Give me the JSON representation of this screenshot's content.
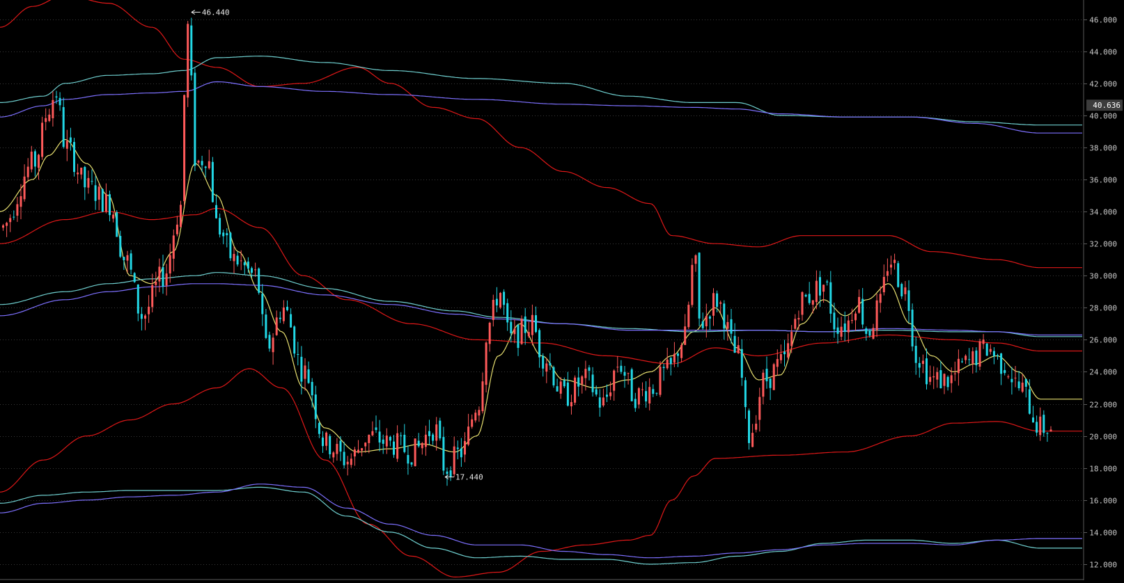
{
  "chart_data": {
    "type": "candlestick",
    "y_axis": {
      "position": "right",
      "range": [
        11.0,
        47.2
      ],
      "ticks": [
        "46.000",
        "44.000",
        "42.000",
        "40.000",
        "38.000",
        "36.000",
        "34.000",
        "32.000",
        "30.000",
        "28.000",
        "26.000",
        "24.000",
        "22.000",
        "20.000",
        "18.000",
        "16.000",
        "14.000",
        "12.000"
      ]
    },
    "grid": "dotted horizontal",
    "current_price_label": "40.636",
    "current_price_value": 40.636,
    "annotations": [
      {
        "text": "46.440",
        "value": 46.44,
        "kind": "period-high",
        "x_frac": 0.176
      },
      {
        "text": "17.440",
        "value": 17.44,
        "kind": "period-low",
        "x_frac": 0.41
      }
    ],
    "colors": {
      "background": "#000000",
      "grid": "#3a3a3a",
      "axis_text": "#c8c8c8",
      "up_candle": "#ff5a5a",
      "down_candle": "#22d8e6",
      "ma_short": "#e8e070",
      "band_red": "#e01818",
      "band_cyan": "#6fd0d0",
      "band_blue": "#7d70ff",
      "price_box_bg": "#3c3c3c"
    },
    "price_path": [
      [
        0.0,
        33.0
      ],
      [
        0.03,
        37.0
      ],
      [
        0.045,
        40.5
      ],
      [
        0.05,
        41.5
      ],
      [
        0.06,
        38.0
      ],
      [
        0.08,
        35.5
      ],
      [
        0.1,
        34.5
      ],
      [
        0.115,
        31.0
      ],
      [
        0.13,
        27.5
      ],
      [
        0.15,
        30.0
      ],
      [
        0.165,
        34.0
      ],
      [
        0.172,
        45.5
      ],
      [
        0.18,
        37.0
      ],
      [
        0.19,
        37.5
      ],
      [
        0.2,
        33.0
      ],
      [
        0.215,
        31.0
      ],
      [
        0.235,
        30.0
      ],
      [
        0.245,
        25.5
      ],
      [
        0.26,
        28.0
      ],
      [
        0.28,
        24.0
      ],
      [
        0.3,
        19.5
      ],
      [
        0.32,
        18.5
      ],
      [
        0.34,
        20.0
      ],
      [
        0.36,
        19.5
      ],
      [
        0.38,
        19.0
      ],
      [
        0.4,
        20.5
      ],
      [
        0.41,
        18.0
      ],
      [
        0.425,
        19.0
      ],
      [
        0.44,
        22.0
      ],
      [
        0.45,
        27.0
      ],
      [
        0.46,
        29.0
      ],
      [
        0.47,
        26.0
      ],
      [
        0.49,
        27.0
      ],
      [
        0.5,
        25.0
      ],
      [
        0.52,
        22.5
      ],
      [
        0.54,
        23.5
      ],
      [
        0.555,
        22.0
      ],
      [
        0.57,
        24.5
      ],
      [
        0.585,
        22.5
      ],
      [
        0.6,
        23.0
      ],
      [
        0.615,
        24.0
      ],
      [
        0.63,
        26.0
      ],
      [
        0.64,
        31.0
      ],
      [
        0.645,
        27.0
      ],
      [
        0.66,
        28.5
      ],
      [
        0.68,
        25.0
      ],
      [
        0.69,
        20.0
      ],
      [
        0.705,
        23.5
      ],
      [
        0.72,
        24.5
      ],
      [
        0.74,
        28.5
      ],
      [
        0.76,
        29.5
      ],
      [
        0.77,
        27.0
      ],
      [
        0.78,
        27.0
      ],
      [
        0.79,
        28.5
      ],
      [
        0.8,
        26.5
      ],
      [
        0.81,
        28.0
      ],
      [
        0.82,
        31.0
      ],
      [
        0.835,
        29.0
      ],
      [
        0.845,
        25.0
      ],
      [
        0.86,
        23.5
      ],
      [
        0.875,
        23.5
      ],
      [
        0.89,
        24.5
      ],
      [
        0.91,
        25.5
      ],
      [
        0.925,
        24.5
      ],
      [
        0.94,
        23.0
      ],
      [
        0.96,
        20.5
      ]
    ],
    "moving_averages": [
      {
        "color_key": "ma_short",
        "values": [
          [
            0.0,
            34.0
          ],
          [
            0.03,
            36.0
          ],
          [
            0.045,
            37.5
          ],
          [
            0.06,
            38.5
          ],
          [
            0.08,
            37.0
          ],
          [
            0.1,
            35.0
          ],
          [
            0.12,
            30.0
          ],
          [
            0.14,
            29.5
          ],
          [
            0.16,
            31.5
          ],
          [
            0.18,
            37.0
          ],
          [
            0.2,
            35.0
          ],
          [
            0.22,
            31.5
          ],
          [
            0.24,
            29.0
          ],
          [
            0.26,
            26.5
          ],
          [
            0.28,
            23.0
          ],
          [
            0.3,
            20.5
          ],
          [
            0.33,
            19.0
          ],
          [
            0.36,
            19.2
          ],
          [
            0.39,
            19.5
          ],
          [
            0.42,
            19.0
          ],
          [
            0.44,
            20.0
          ],
          [
            0.46,
            25.0
          ],
          [
            0.48,
            27.0
          ],
          [
            0.5,
            25.0
          ],
          [
            0.52,
            23.5
          ],
          [
            0.55,
            23.0
          ],
          [
            0.58,
            23.5
          ],
          [
            0.6,
            24.0
          ],
          [
            0.62,
            25.0
          ],
          [
            0.64,
            26.5
          ],
          [
            0.66,
            28.0
          ],
          [
            0.68,
            25.5
          ],
          [
            0.7,
            23.5
          ],
          [
            0.72,
            23.8
          ],
          [
            0.74,
            27.0
          ],
          [
            0.76,
            28.5
          ],
          [
            0.78,
            27.5
          ],
          [
            0.8,
            28.5
          ],
          [
            0.82,
            29.5
          ],
          [
            0.84,
            27.0
          ],
          [
            0.86,
            25.0
          ],
          [
            0.88,
            24.0
          ],
          [
            0.9,
            24.5
          ],
          [
            0.92,
            25.0
          ],
          [
            0.94,
            24.0
          ],
          [
            0.96,
            22.3
          ]
        ]
      },
      {
        "color_key": "band_red",
        "values": [
          [
            0.0,
            32.0
          ],
          [
            0.06,
            33.5
          ],
          [
            0.1,
            34.0
          ],
          [
            0.14,
            33.5
          ],
          [
            0.18,
            33.8
          ],
          [
            0.2,
            34.2
          ],
          [
            0.24,
            33.0
          ],
          [
            0.28,
            30.0
          ],
          [
            0.32,
            28.5
          ],
          [
            0.38,
            27.0
          ],
          [
            0.44,
            26.0
          ],
          [
            0.5,
            25.8
          ],
          [
            0.56,
            25.0
          ],
          [
            0.62,
            24.5
          ],
          [
            0.66,
            25.5
          ],
          [
            0.7,
            25.0
          ],
          [
            0.76,
            25.8
          ],
          [
            0.82,
            26.3
          ],
          [
            0.88,
            26.0
          ],
          [
            0.92,
            25.8
          ],
          [
            0.96,
            25.3
          ]
        ]
      },
      {
        "color_key": "band_red",
        "values": [
          [
            0.0,
            45.5
          ],
          [
            0.03,
            46.8
          ],
          [
            0.06,
            47.5
          ],
          [
            0.1,
            47.0
          ],
          [
            0.14,
            45.5
          ],
          [
            0.17,
            43.5
          ],
          [
            0.2,
            43.0
          ],
          [
            0.24,
            41.8
          ],
          [
            0.28,
            42.0
          ],
          [
            0.33,
            43.0
          ],
          [
            0.36,
            42.0
          ],
          [
            0.4,
            40.5
          ],
          [
            0.44,
            39.8
          ],
          [
            0.48,
            38.0
          ],
          [
            0.52,
            36.5
          ],
          [
            0.56,
            35.5
          ],
          [
            0.6,
            34.5
          ],
          [
            0.62,
            32.5
          ],
          [
            0.66,
            32.0
          ],
          [
            0.7,
            31.8
          ],
          [
            0.74,
            32.5
          ],
          [
            0.78,
            32.5
          ],
          [
            0.82,
            32.5
          ],
          [
            0.86,
            31.5
          ],
          [
            0.92,
            31.0
          ],
          [
            0.96,
            30.5
          ]
        ]
      },
      {
        "color_key": "band_red",
        "values": [
          [
            0.0,
            16.5
          ],
          [
            0.04,
            18.5
          ],
          [
            0.08,
            20.0
          ],
          [
            0.12,
            21.0
          ],
          [
            0.16,
            22.0
          ],
          [
            0.2,
            23.0
          ],
          [
            0.23,
            24.2
          ],
          [
            0.26,
            23.0
          ],
          [
            0.3,
            18.5
          ],
          [
            0.34,
            14.5
          ],
          [
            0.38,
            12.5
          ],
          [
            0.42,
            11.2
          ],
          [
            0.46,
            11.5
          ],
          [
            0.5,
            12.8
          ],
          [
            0.54,
            13.2
          ],
          [
            0.58,
            13.5
          ],
          [
            0.6,
            13.8
          ],
          [
            0.62,
            16.0
          ],
          [
            0.64,
            17.5
          ],
          [
            0.66,
            18.6
          ],
          [
            0.72,
            18.8
          ],
          [
            0.78,
            19.0
          ],
          [
            0.84,
            20.0
          ],
          [
            0.88,
            20.8
          ],
          [
            0.92,
            20.9
          ],
          [
            0.96,
            20.3
          ]
        ]
      },
      {
        "color_key": "band_cyan",
        "values": [
          [
            0.0,
            40.8
          ],
          [
            0.04,
            41.2
          ],
          [
            0.06,
            42.0
          ],
          [
            0.1,
            42.5
          ],
          [
            0.14,
            42.6
          ],
          [
            0.17,
            42.8
          ],
          [
            0.2,
            43.6
          ],
          [
            0.24,
            43.7
          ],
          [
            0.3,
            43.3
          ],
          [
            0.36,
            42.8
          ],
          [
            0.44,
            42.3
          ],
          [
            0.52,
            42.0
          ],
          [
            0.58,
            41.2
          ],
          [
            0.64,
            40.8
          ],
          [
            0.68,
            40.8
          ],
          [
            0.72,
            40.0
          ],
          [
            0.78,
            39.9
          ],
          [
            0.84,
            39.9
          ],
          [
            0.9,
            39.6
          ],
          [
            0.96,
            39.4
          ]
        ]
      },
      {
        "color_key": "band_blue",
        "values": [
          [
            0.0,
            39.9
          ],
          [
            0.04,
            40.6
          ],
          [
            0.06,
            41.0
          ],
          [
            0.1,
            41.3
          ],
          [
            0.14,
            41.4
          ],
          [
            0.17,
            41.5
          ],
          [
            0.2,
            42.1
          ],
          [
            0.24,
            41.8
          ],
          [
            0.3,
            41.5
          ],
          [
            0.36,
            41.3
          ],
          [
            0.44,
            41.0
          ],
          [
            0.52,
            40.7
          ],
          [
            0.58,
            40.6
          ],
          [
            0.64,
            40.5
          ],
          [
            0.68,
            40.4
          ],
          [
            0.72,
            40.1
          ],
          [
            0.78,
            39.9
          ],
          [
            0.84,
            39.9
          ],
          [
            0.9,
            39.5
          ],
          [
            0.96,
            38.9
          ]
        ]
      },
      {
        "color_key": "band_cyan",
        "values": [
          [
            0.0,
            28.2
          ],
          [
            0.06,
            29.0
          ],
          [
            0.1,
            29.5
          ],
          [
            0.14,
            29.8
          ],
          [
            0.18,
            30.0
          ],
          [
            0.2,
            30.2
          ],
          [
            0.24,
            30.0
          ],
          [
            0.3,
            29.2
          ],
          [
            0.36,
            28.4
          ],
          [
            0.42,
            27.8
          ],
          [
            0.46,
            27.4
          ],
          [
            0.52,
            27.0
          ],
          [
            0.58,
            26.7
          ],
          [
            0.64,
            26.5
          ],
          [
            0.7,
            26.6
          ],
          [
            0.76,
            26.5
          ],
          [
            0.82,
            26.6
          ],
          [
            0.88,
            26.5
          ],
          [
            0.92,
            26.5
          ],
          [
            0.96,
            26.2
          ]
        ]
      },
      {
        "color_key": "band_blue",
        "values": [
          [
            0.0,
            27.5
          ],
          [
            0.06,
            28.5
          ],
          [
            0.1,
            29.0
          ],
          [
            0.14,
            29.3
          ],
          [
            0.18,
            29.5
          ],
          [
            0.2,
            29.5
          ],
          [
            0.24,
            29.4
          ],
          [
            0.3,
            28.8
          ],
          [
            0.36,
            28.2
          ],
          [
            0.42,
            27.6
          ],
          [
            0.46,
            27.3
          ],
          [
            0.52,
            27.0
          ],
          [
            0.58,
            26.6
          ],
          [
            0.64,
            26.6
          ],
          [
            0.7,
            26.6
          ],
          [
            0.76,
            26.5
          ],
          [
            0.82,
            26.7
          ],
          [
            0.88,
            26.6
          ],
          [
            0.92,
            26.5
          ],
          [
            0.96,
            26.3
          ]
        ]
      },
      {
        "color_key": "band_cyan",
        "values": [
          [
            0.0,
            15.8
          ],
          [
            0.04,
            16.3
          ],
          [
            0.08,
            16.5
          ],
          [
            0.12,
            16.6
          ],
          [
            0.16,
            16.6
          ],
          [
            0.2,
            16.6
          ],
          [
            0.24,
            16.8
          ],
          [
            0.28,
            16.5
          ],
          [
            0.32,
            15.0
          ],
          [
            0.36,
            14.0
          ],
          [
            0.4,
            13.0
          ],
          [
            0.44,
            12.4
          ],
          [
            0.48,
            12.5
          ],
          [
            0.52,
            12.3
          ],
          [
            0.56,
            12.3
          ],
          [
            0.6,
            12.0
          ],
          [
            0.64,
            12.1
          ],
          [
            0.68,
            12.5
          ],
          [
            0.72,
            12.8
          ],
          [
            0.76,
            13.3
          ],
          [
            0.8,
            13.5
          ],
          [
            0.84,
            13.5
          ],
          [
            0.88,
            13.3
          ],
          [
            0.92,
            13.5
          ],
          [
            0.96,
            13.0
          ]
        ]
      },
      {
        "color_key": "band_blue",
        "values": [
          [
            0.0,
            15.2
          ],
          [
            0.04,
            15.8
          ],
          [
            0.08,
            16.0
          ],
          [
            0.12,
            16.2
          ],
          [
            0.16,
            16.3
          ],
          [
            0.2,
            16.5
          ],
          [
            0.24,
            17.0
          ],
          [
            0.28,
            16.8
          ],
          [
            0.32,
            15.5
          ],
          [
            0.36,
            14.5
          ],
          [
            0.4,
            13.8
          ],
          [
            0.44,
            13.2
          ],
          [
            0.48,
            13.2
          ],
          [
            0.52,
            12.8
          ],
          [
            0.56,
            12.6
          ],
          [
            0.6,
            12.4
          ],
          [
            0.64,
            12.5
          ],
          [
            0.68,
            12.7
          ],
          [
            0.72,
            12.9
          ],
          [
            0.76,
            13.2
          ],
          [
            0.8,
            13.3
          ],
          [
            0.84,
            13.3
          ],
          [
            0.88,
            13.2
          ],
          [
            0.92,
            13.5
          ],
          [
            0.96,
            13.6
          ]
        ]
      }
    ]
  }
}
